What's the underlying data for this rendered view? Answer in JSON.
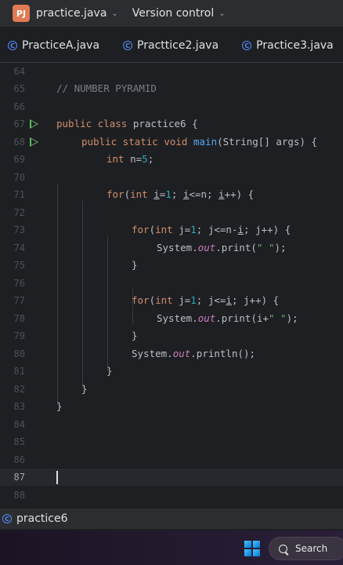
{
  "titlebar": {
    "project_badge": "PJ",
    "project_name": "practice.java",
    "version_control": "Version control"
  },
  "tabs": [
    {
      "icon": "C",
      "label": "PracticeA.java"
    },
    {
      "icon": "C",
      "label": "Practtice2.java"
    },
    {
      "icon": "C",
      "label": "Practice3.java"
    }
  ],
  "editor": {
    "line_numbers": [
      "64",
      "65",
      "66",
      "67",
      "68",
      "69",
      "70",
      "71",
      "72",
      "73",
      "74",
      "75",
      "76",
      "77",
      "78",
      "79",
      "80",
      "81",
      "82",
      "83",
      "84",
      "85",
      "86",
      "87",
      "88"
    ],
    "tokens": {
      "l65_comment": "// NUMBER PYRAMID",
      "l67_kw": "public class",
      "l67_rest": " practice6 {",
      "l68_kw": "public static void",
      "l68_fn": "main",
      "l68_rest": "(String[] args) {",
      "l69_kw": "int",
      "l69_var": " n=",
      "l69_num": "5",
      "l69_end": ";",
      "l71_kw1": "for",
      "l71_p1": "(",
      "l71_kw2": "int",
      "l71_sp": " ",
      "l71_i1": "i",
      "l71_eq": "=",
      "l71_num": "1",
      "l71_semi": "; ",
      "l71_i2": "i",
      "l71_cond": "<=n; ",
      "l71_i3": "i",
      "l71_end": "++) {",
      "l73_kw1": "for",
      "l73_p1": "(",
      "l73_kw2": "int",
      "l73_a": " j=",
      "l73_num": "1",
      "l73_b": "; j<=n-",
      "l73_i": "i",
      "l73_c": "; j++) {",
      "l74_a": "System.",
      "l74_out": "out",
      "l74_b": ".print(",
      "l74_str": "\" \"",
      "l74_c": ");",
      "l75": "}",
      "l77_kw1": "for",
      "l77_p1": "(",
      "l77_kw2": "int",
      "l77_a": " j=",
      "l77_num": "1",
      "l77_b": "; j<=",
      "l77_i": "i",
      "l77_c": "; j++) {",
      "l78_a": "System.",
      "l78_out": "out",
      "l78_b": ".print(i+",
      "l78_str": "\" \"",
      "l78_c": ");",
      "l79": "}",
      "l80_a": "System.",
      "l80_out": "out",
      "l80_b": ".println();",
      "l81": "}",
      "l82": "}",
      "l83": "}"
    }
  },
  "statusbar": {
    "icon": "C",
    "label": "practice6"
  },
  "taskbar": {
    "search_label": "Search"
  },
  "colors": {
    "background": "#1e1f22",
    "keyword": "#cf8e6d",
    "number": "#2aacb8",
    "string": "#6aab73",
    "method": "#56a8f5",
    "field": "#c77dbb",
    "comment": "#7a7e85",
    "run_icon": "#5fb865",
    "class_icon": "#548af7"
  }
}
